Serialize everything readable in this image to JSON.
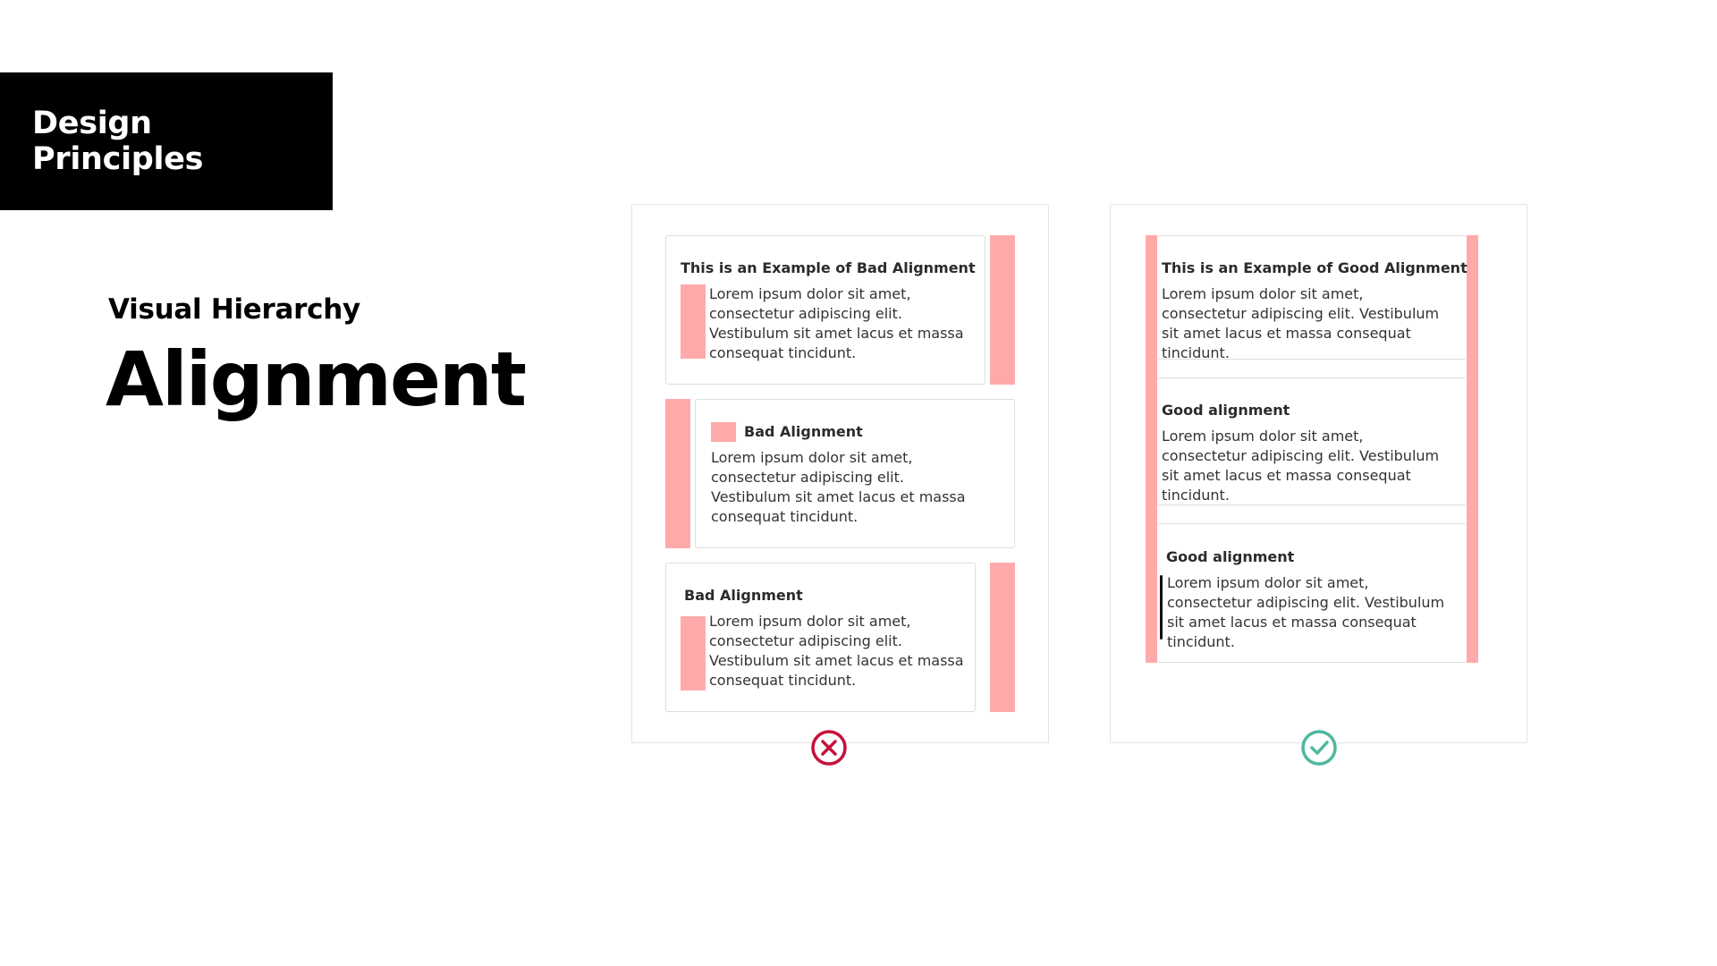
{
  "header": {
    "brand": "Design Principles"
  },
  "section": {
    "label": "Visual Hierarchy",
    "title": "Alignment"
  },
  "bad_example": {
    "cards": [
      {
        "title": "This is an Example of Bad Alignment",
        "text": "Lorem ipsum dolor sit amet, consectetur adipiscing elit. Vestibulum sit amet lacus et massa consequat tincidunt."
      },
      {
        "title": "Bad Alignment",
        "text": "Lorem ipsum dolor sit amet, consectetur adipiscing elit. Vestibulum sit amet lacus et massa consequat tincidunt."
      },
      {
        "title": "Bad Alignment",
        "text": "Lorem ipsum dolor sit amet, consectetur adipiscing elit. Vestibulum sit amet lacus et massa consequat tincidunt."
      }
    ],
    "status_icon": "cross-circle-icon"
  },
  "good_example": {
    "cards": [
      {
        "title": "This is an Example of Good Alignment",
        "text": "Lorem ipsum dolor sit amet, consectetur adipiscing elit. Vestibulum sit amet lacus et massa consequat tincidunt."
      },
      {
        "title": "Good alignment",
        "text": "Lorem ipsum dolor sit amet, consectetur adipiscing elit. Vestibulum sit amet lacus et massa consequat tincidunt."
      },
      {
        "title": "Good alignment",
        "text": "Lorem ipsum dolor sit amet, consectetur adipiscing elit. Vestibulum sit amet lacus et massa consequat tincidunt."
      }
    ],
    "status_icon": "check-circle-icon"
  },
  "colors": {
    "highlight": "#ffaaaa",
    "bad": "#c8103c",
    "good": "#4db89e"
  }
}
